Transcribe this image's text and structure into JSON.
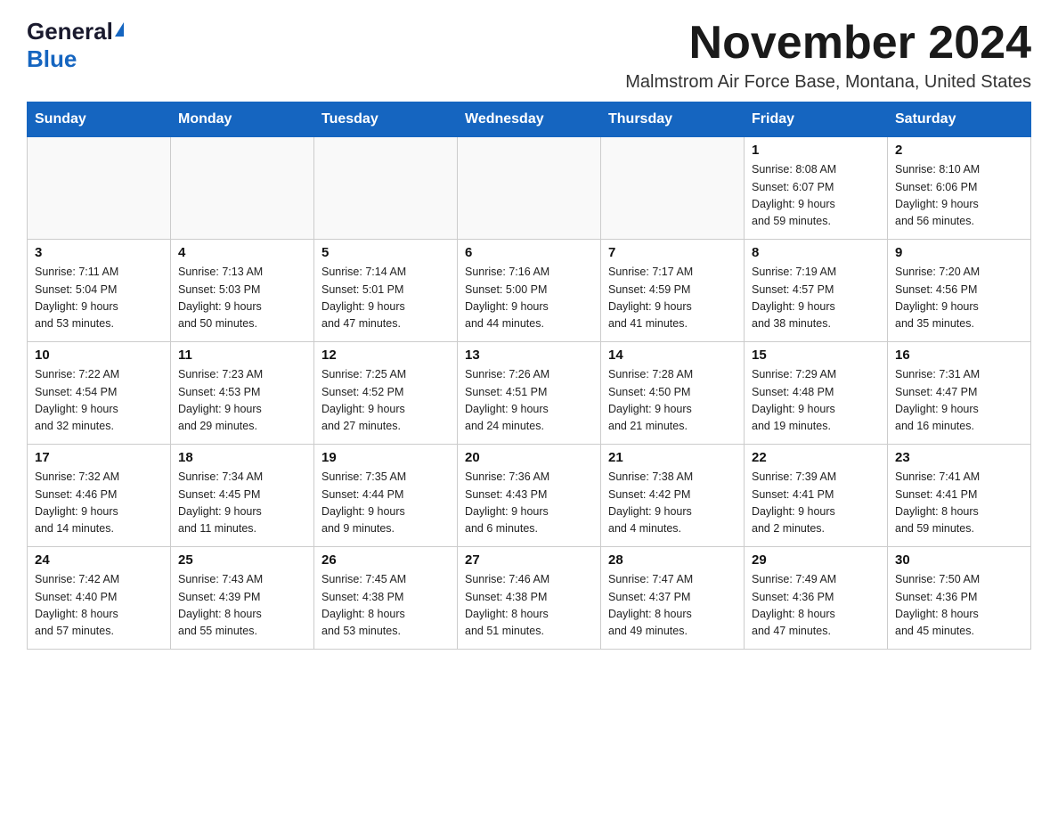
{
  "logo": {
    "general": "General",
    "blue": "Blue"
  },
  "header": {
    "title": "November 2024",
    "subtitle": "Malmstrom Air Force Base, Montana, United States"
  },
  "weekdays": [
    "Sunday",
    "Monday",
    "Tuesday",
    "Wednesday",
    "Thursday",
    "Friday",
    "Saturday"
  ],
  "weeks": [
    [
      {
        "day": "",
        "info": ""
      },
      {
        "day": "",
        "info": ""
      },
      {
        "day": "",
        "info": ""
      },
      {
        "day": "",
        "info": ""
      },
      {
        "day": "",
        "info": ""
      },
      {
        "day": "1",
        "info": "Sunrise: 8:08 AM\nSunset: 6:07 PM\nDaylight: 9 hours\nand 59 minutes."
      },
      {
        "day": "2",
        "info": "Sunrise: 8:10 AM\nSunset: 6:06 PM\nDaylight: 9 hours\nand 56 minutes."
      }
    ],
    [
      {
        "day": "3",
        "info": "Sunrise: 7:11 AM\nSunset: 5:04 PM\nDaylight: 9 hours\nand 53 minutes."
      },
      {
        "day": "4",
        "info": "Sunrise: 7:13 AM\nSunset: 5:03 PM\nDaylight: 9 hours\nand 50 minutes."
      },
      {
        "day": "5",
        "info": "Sunrise: 7:14 AM\nSunset: 5:01 PM\nDaylight: 9 hours\nand 47 minutes."
      },
      {
        "day": "6",
        "info": "Sunrise: 7:16 AM\nSunset: 5:00 PM\nDaylight: 9 hours\nand 44 minutes."
      },
      {
        "day": "7",
        "info": "Sunrise: 7:17 AM\nSunset: 4:59 PM\nDaylight: 9 hours\nand 41 minutes."
      },
      {
        "day": "8",
        "info": "Sunrise: 7:19 AM\nSunset: 4:57 PM\nDaylight: 9 hours\nand 38 minutes."
      },
      {
        "day": "9",
        "info": "Sunrise: 7:20 AM\nSunset: 4:56 PM\nDaylight: 9 hours\nand 35 minutes."
      }
    ],
    [
      {
        "day": "10",
        "info": "Sunrise: 7:22 AM\nSunset: 4:54 PM\nDaylight: 9 hours\nand 32 minutes."
      },
      {
        "day": "11",
        "info": "Sunrise: 7:23 AM\nSunset: 4:53 PM\nDaylight: 9 hours\nand 29 minutes."
      },
      {
        "day": "12",
        "info": "Sunrise: 7:25 AM\nSunset: 4:52 PM\nDaylight: 9 hours\nand 27 minutes."
      },
      {
        "day": "13",
        "info": "Sunrise: 7:26 AM\nSunset: 4:51 PM\nDaylight: 9 hours\nand 24 minutes."
      },
      {
        "day": "14",
        "info": "Sunrise: 7:28 AM\nSunset: 4:50 PM\nDaylight: 9 hours\nand 21 minutes."
      },
      {
        "day": "15",
        "info": "Sunrise: 7:29 AM\nSunset: 4:48 PM\nDaylight: 9 hours\nand 19 minutes."
      },
      {
        "day": "16",
        "info": "Sunrise: 7:31 AM\nSunset: 4:47 PM\nDaylight: 9 hours\nand 16 minutes."
      }
    ],
    [
      {
        "day": "17",
        "info": "Sunrise: 7:32 AM\nSunset: 4:46 PM\nDaylight: 9 hours\nand 14 minutes."
      },
      {
        "day": "18",
        "info": "Sunrise: 7:34 AM\nSunset: 4:45 PM\nDaylight: 9 hours\nand 11 minutes."
      },
      {
        "day": "19",
        "info": "Sunrise: 7:35 AM\nSunset: 4:44 PM\nDaylight: 9 hours\nand 9 minutes."
      },
      {
        "day": "20",
        "info": "Sunrise: 7:36 AM\nSunset: 4:43 PM\nDaylight: 9 hours\nand 6 minutes."
      },
      {
        "day": "21",
        "info": "Sunrise: 7:38 AM\nSunset: 4:42 PM\nDaylight: 9 hours\nand 4 minutes."
      },
      {
        "day": "22",
        "info": "Sunrise: 7:39 AM\nSunset: 4:41 PM\nDaylight: 9 hours\nand 2 minutes."
      },
      {
        "day": "23",
        "info": "Sunrise: 7:41 AM\nSunset: 4:41 PM\nDaylight: 8 hours\nand 59 minutes."
      }
    ],
    [
      {
        "day": "24",
        "info": "Sunrise: 7:42 AM\nSunset: 4:40 PM\nDaylight: 8 hours\nand 57 minutes."
      },
      {
        "day": "25",
        "info": "Sunrise: 7:43 AM\nSunset: 4:39 PM\nDaylight: 8 hours\nand 55 minutes."
      },
      {
        "day": "26",
        "info": "Sunrise: 7:45 AM\nSunset: 4:38 PM\nDaylight: 8 hours\nand 53 minutes."
      },
      {
        "day": "27",
        "info": "Sunrise: 7:46 AM\nSunset: 4:38 PM\nDaylight: 8 hours\nand 51 minutes."
      },
      {
        "day": "28",
        "info": "Sunrise: 7:47 AM\nSunset: 4:37 PM\nDaylight: 8 hours\nand 49 minutes."
      },
      {
        "day": "29",
        "info": "Sunrise: 7:49 AM\nSunset: 4:36 PM\nDaylight: 8 hours\nand 47 minutes."
      },
      {
        "day": "30",
        "info": "Sunrise: 7:50 AM\nSunset: 4:36 PM\nDaylight: 8 hours\nand 45 minutes."
      }
    ]
  ]
}
